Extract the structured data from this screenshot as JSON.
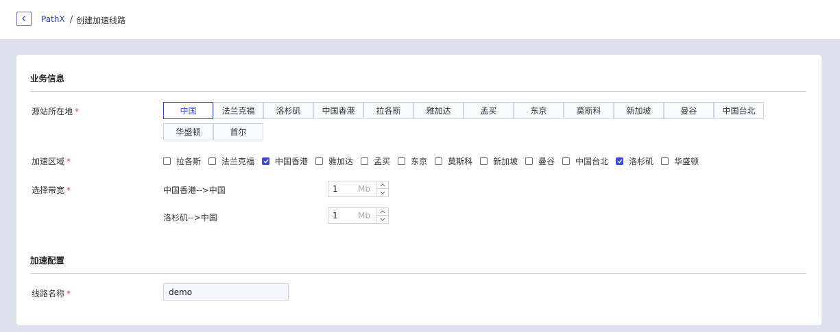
{
  "breadcrumb": {
    "root": "PathX",
    "separator": "/",
    "current": "创建加速线路"
  },
  "sections": {
    "business_info": "业务信息",
    "accel_config": "加速配置"
  },
  "fields": {
    "source_location": "源站所在地",
    "accel_region": "加速区域",
    "bandwidth": "选择带宽",
    "line_name": "线路名称",
    "required_mark": "*"
  },
  "source_locations": {
    "selected": "中国",
    "options": [
      "中国",
      "法兰克福",
      "洛杉矶",
      "中国香港",
      "拉各斯",
      "雅加达",
      "孟买",
      "东京",
      "莫斯科",
      "新加坡",
      "曼谷",
      "中国台北",
      "华盛顿",
      "首尔"
    ]
  },
  "accel_regions": [
    {
      "label": "拉各斯",
      "checked": false
    },
    {
      "label": "法兰克福",
      "checked": false
    },
    {
      "label": "中国香港",
      "checked": true
    },
    {
      "label": "雅加达",
      "checked": false
    },
    {
      "label": "孟买",
      "checked": false
    },
    {
      "label": "东京",
      "checked": false
    },
    {
      "label": "莫斯科",
      "checked": false
    },
    {
      "label": "新加坡",
      "checked": false
    },
    {
      "label": "曼谷",
      "checked": false
    },
    {
      "label": "中国台北",
      "checked": false
    },
    {
      "label": "洛杉矶",
      "checked": true
    },
    {
      "label": "华盛顿",
      "checked": false
    }
  ],
  "bandwidths": [
    {
      "route": "中国香港-->中国",
      "value": "1",
      "unit": "Mb"
    },
    {
      "route": "洛杉矶-->中国",
      "value": "1",
      "unit": "Mb"
    }
  ],
  "line_name_value": "demo",
  "colors": {
    "accent": "#3b4ccc",
    "required": "#e04040",
    "page_bg": "#dfe1ec"
  }
}
